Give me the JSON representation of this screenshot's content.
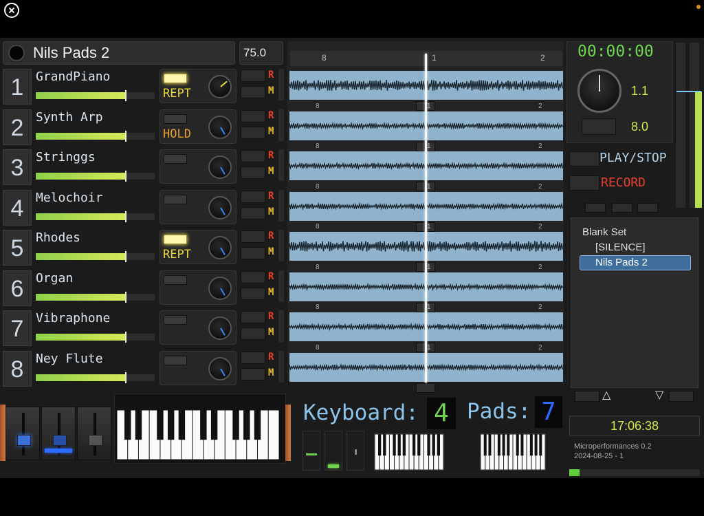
{
  "header": {
    "set_title": "Nils Pads 2",
    "tempo": "75.0"
  },
  "tracks": [
    {
      "number": "1",
      "name": "GrandPiano",
      "level": 0.75,
      "led_on": true,
      "mode": "REPT",
      "mode_kind": "repeat"
    },
    {
      "number": "2",
      "name": "Synth Arp",
      "level": 0.75,
      "led_on": false,
      "mode": "HOLD",
      "mode_kind": "hold"
    },
    {
      "number": "3",
      "name": "Stringgs",
      "level": 0.75,
      "led_on": false,
      "mode": "",
      "mode_kind": ""
    },
    {
      "number": "4",
      "name": "Melochoir",
      "level": 0.75,
      "led_on": false,
      "mode": "",
      "mode_kind": ""
    },
    {
      "number": "5",
      "name": "Rhodes",
      "level": 0.75,
      "led_on": true,
      "mode": "REPT",
      "mode_kind": "repeat"
    },
    {
      "number": "6",
      "name": "Organ",
      "level": 0.75,
      "led_on": false,
      "mode": "",
      "mode_kind": ""
    },
    {
      "number": "7",
      "name": "Vibraphone",
      "level": 0.75,
      "led_on": false,
      "mode": "",
      "mode_kind": ""
    },
    {
      "number": "8",
      "name": "Ney Flute",
      "level": 0.75,
      "led_on": false,
      "mode": "",
      "mode_kind": ""
    }
  ],
  "track_buttons": {
    "record_label": "R",
    "mute_label": "M"
  },
  "timeline": {
    "ruler_labels": [
      "8",
      "1",
      "2"
    ]
  },
  "transport": {
    "timecode": "00:00:00",
    "value_top": "1.1",
    "value_bottom": "8.0",
    "play_label": "PLAY/STOP",
    "record_label": "RECORD"
  },
  "setlist": {
    "items": [
      {
        "label": "Blank Set",
        "selected": false
      },
      {
        "label": "[SILENCE]",
        "selected": false
      },
      {
        "label": "Nils Pads 2",
        "selected": true
      }
    ],
    "up_arrow": "△",
    "down_arrow": "▽"
  },
  "status": {
    "clock": "17:06:38",
    "app_version": "Microperformances 0.2",
    "build_date": "2024-08-25 - 1",
    "progress": 0.08
  },
  "keyboard": {
    "keyboard_label": "Keyboard:",
    "keyboard_channel": "4",
    "pads_label": "Pads:",
    "pads_channel": "7"
  },
  "colors": {
    "accent_green": "#6fd44f",
    "accent_yellow": "#d8e84a",
    "record_red": "#e8402a",
    "label_blue": "#8cc3ea",
    "wave_blue": "#8fb3cc"
  }
}
